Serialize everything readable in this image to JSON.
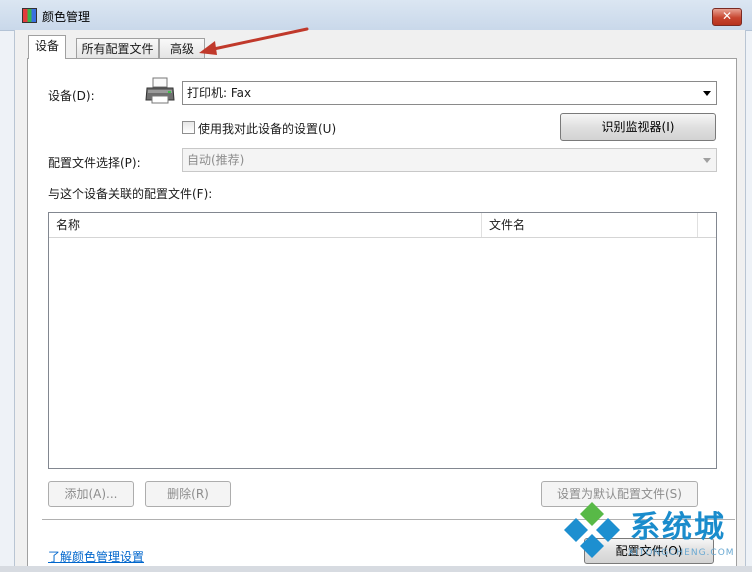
{
  "window": {
    "title": "颜色管理",
    "close_label": "✕"
  },
  "tabs": [
    {
      "label": "设备"
    },
    {
      "label": "所有配置文件"
    },
    {
      "label": "高级"
    }
  ],
  "device": {
    "label": "设备(D):",
    "selected": "打印机: Fax",
    "use_settings_label": "使用我对此设备的设置(U)",
    "identify_button": "识别监视器(I)"
  },
  "profile_select": {
    "label": "配置文件选择(P):",
    "value": "自动(推荐)"
  },
  "associated": {
    "label": "与这个设备关联的配置文件(F):",
    "columns": [
      "名称",
      "文件名"
    ],
    "rows": []
  },
  "buttons": {
    "add": "添加(A)...",
    "remove": "删除(R)",
    "set_default": "设置为默认配置文件(S)",
    "profiles": "配置文件(O)"
  },
  "footer": {
    "link": "了解颜色管理设置"
  },
  "watermark": {
    "text": "系统城",
    "sub": "XITONGCHENG.COM"
  },
  "colors": {
    "accent": "#1a8ccc",
    "annotation_arrow": "#c0392b"
  }
}
